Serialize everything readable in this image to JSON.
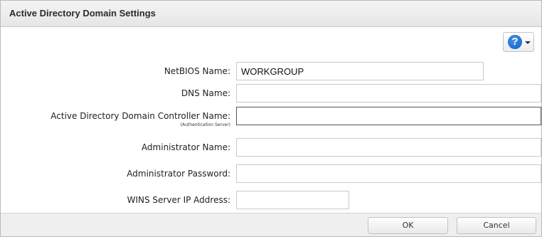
{
  "dialog": {
    "title": "Active Directory Domain Settings",
    "help_icon": "question-circle-icon",
    "accent_color": "#1563c4"
  },
  "form": {
    "netbios": {
      "label": "NetBIOS Name:",
      "value": "WORKGROUP"
    },
    "dns": {
      "label": "DNS Name:",
      "value": ""
    },
    "dc": {
      "label": "Active Directory Domain Controller Name:",
      "sublabel": "(Authentication Server)",
      "value": ""
    },
    "admin_name": {
      "label": "Administrator Name:",
      "value": ""
    },
    "admin_password": {
      "label": "Administrator Password:",
      "value": ""
    },
    "wins": {
      "label": "WINS Server IP Address:",
      "value": ""
    }
  },
  "footer": {
    "ok_label": "OK",
    "cancel_label": "Cancel"
  }
}
